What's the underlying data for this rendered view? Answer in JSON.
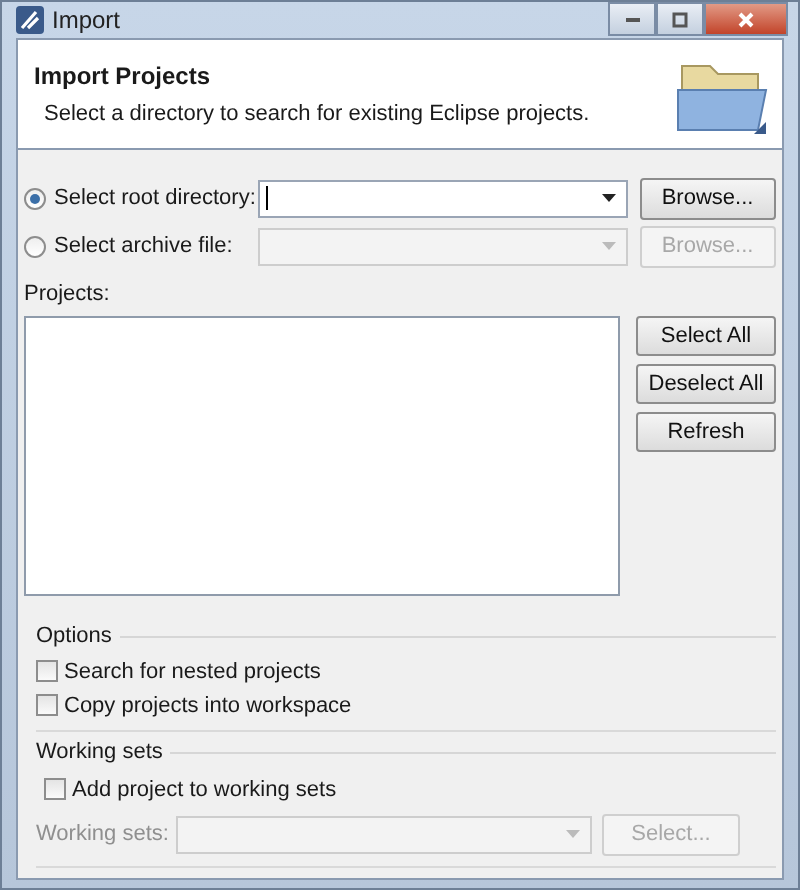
{
  "window": {
    "title": "Import"
  },
  "header": {
    "title": "Import Projects",
    "description": "Select a directory to search for existing Eclipse projects."
  },
  "sources": [
    {
      "label": "Select root directory:",
      "selected": true,
      "disabled": false,
      "button": "Browse..."
    },
    {
      "label": "Select archive file:",
      "selected": false,
      "disabled": true,
      "button": "Browse..."
    }
  ],
  "projects": {
    "label": "Projects:",
    "buttons": [
      "Select All",
      "Deselect All",
      "Refresh"
    ]
  },
  "options": {
    "title": "Options",
    "checks": [
      {
        "label": "Search for nested projects",
        "checked": false
      },
      {
        "label": "Copy projects into workspace",
        "checked": false
      }
    ]
  },
  "working_sets": {
    "title": "Working sets",
    "check": {
      "label": "Add project to working sets",
      "checked": false
    },
    "field_label": "Working sets:",
    "disabled": true,
    "button": "Select..."
  }
}
